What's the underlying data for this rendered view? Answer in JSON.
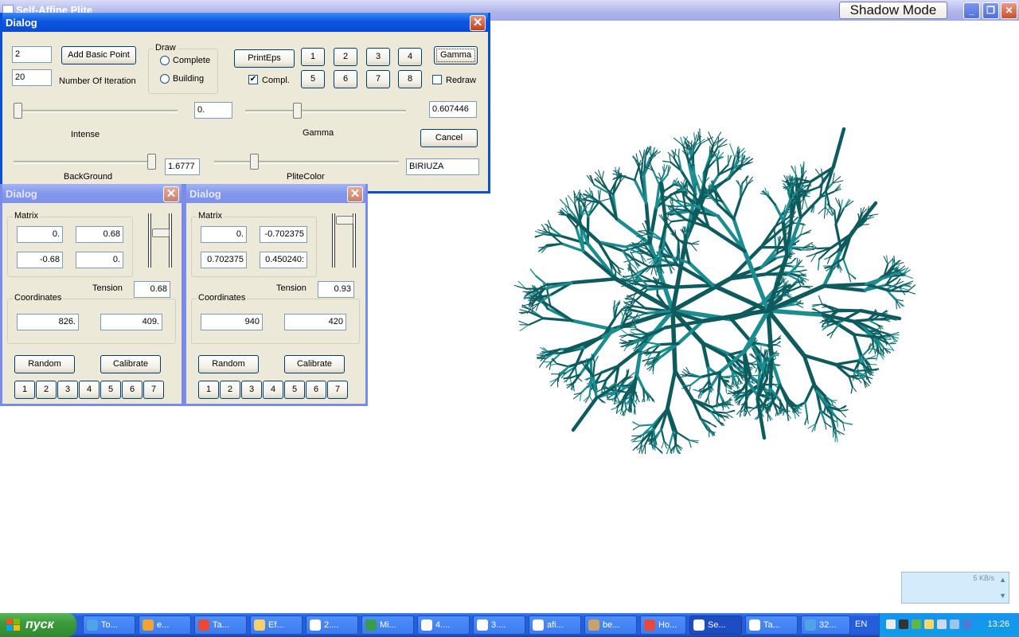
{
  "app": {
    "title": "Self-Affine Plite",
    "shadow_mode_label": "Shadow Mode"
  },
  "main_dialog": {
    "title": "Dialog",
    "points_value": "2",
    "add_basic_point_label": "Add Basic Point",
    "iterations_value": "20",
    "number_of_iteration_label": "Number Of Iteration",
    "draw_group_label": "Draw",
    "complete_label": "Complete",
    "building_label": "Building",
    "print_eps_label": "PrintEps",
    "compl_label": "Compl.",
    "compl_checked_mark": "✔",
    "number_buttons": [
      "1",
      "2",
      "3",
      "4",
      "5",
      "6",
      "7",
      "8"
    ],
    "gamma_button_label": "Gamma",
    "redraw_label": "Redraw",
    "intense_value": "0.",
    "intense_label": "Intense",
    "gamma_value": "0.607446",
    "gamma_label": "Gamma",
    "cancel_label": "Cancel",
    "background_label": "BackGround",
    "background_value": "1.6777",
    "plite_color_label": "PliteColor",
    "plite_color_value": "BIRIUZA"
  },
  "transform_dialogs": [
    {
      "title": "Dialog",
      "matrix_label": "Matrix",
      "matrix": [
        "0.",
        "0.68",
        "-0.68",
        "0."
      ],
      "tension_label": "Tension",
      "tension_value": "0.68",
      "coordinates_label": "Coordinates",
      "coord_x": "826.",
      "coord_y": "409.",
      "random_label": "Random",
      "calibrate_label": "Calibrate",
      "number_buttons": [
        "1",
        "2",
        "3",
        "4",
        "5",
        "6",
        "7"
      ]
    },
    {
      "title": "Dialog",
      "matrix_label": "Matrix",
      "matrix": [
        "0.",
        "-0.702375",
        "0.702375",
        "0.450240:"
      ],
      "tension_label": "Tension",
      "tension_value": "0.93",
      "coordinates_label": "Coordinates",
      "coord_x": "940",
      "coord_y": "420",
      "random_label": "Random",
      "calibrate_label": "Calibrate",
      "number_buttons": [
        "1",
        "2",
        "3",
        "4",
        "5",
        "6",
        "7"
      ]
    }
  ],
  "net_widget": {
    "speed": "5 KB/s"
  },
  "taskbar": {
    "start_label": "пуск",
    "tasks": [
      "To...",
      "e...",
      "Ta...",
      "Ef...",
      "2....",
      "Mi...",
      "4....",
      "3....",
      "afi...",
      "be...",
      "Ho...",
      "Se...",
      "Ta...",
      "32..."
    ],
    "language": "EN",
    "clock": "13:26"
  },
  "colors": {
    "fractal": "#0e5a5c",
    "fractal_light": "#1b8c8f",
    "xp_blue": "#0a4fd8"
  }
}
